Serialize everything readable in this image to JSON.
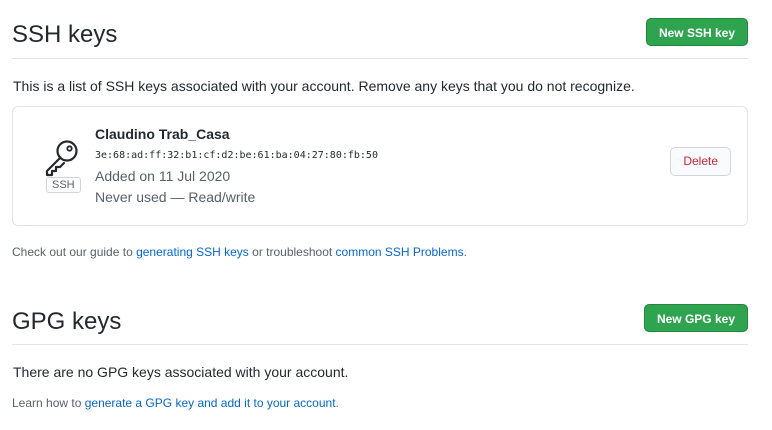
{
  "ssh": {
    "title": "SSH keys",
    "new_button": "New SSH key",
    "description": "This is a list of SSH keys associated with your account. Remove any keys that you do not recognize.",
    "key": {
      "badge": "SSH",
      "name": "Claudino Trab_Casa",
      "fingerprint": "3e:68:ad:ff:32:b1:cf:d2:be:61:ba:04:27:80:fb:50",
      "added": "Added on 11 Jul 2020",
      "usage": "Never used — Read/write",
      "delete_button": "Delete",
      "icon": "key-icon"
    },
    "help": {
      "prefix": "Check out our guide to ",
      "link1": "generating SSH keys",
      "middle": " or troubleshoot ",
      "link2": "common SSH Problems",
      "suffix": "."
    }
  },
  "gpg": {
    "title": "GPG keys",
    "new_button": "New GPG key",
    "empty_text": "There are no GPG keys associated with your account.",
    "help": {
      "prefix": "Learn how to ",
      "link": "generate a GPG key and add it to your account",
      "suffix": "."
    }
  },
  "colors": {
    "primary_button": "#2ea44f",
    "link": "#0366d6",
    "danger": "#cb2431"
  }
}
